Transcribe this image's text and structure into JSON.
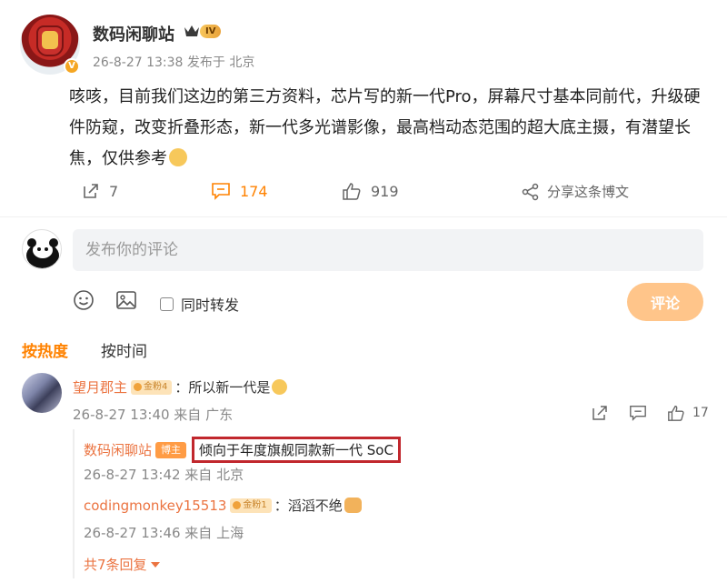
{
  "post": {
    "author": "数码闲聊站",
    "level": "IV",
    "verified": "V",
    "meta": "26-8-27 13:38  发布于 北京",
    "text": "咳咳，目前我们这边的第三方资料，芯片写的新一代Pro，屏幕尺寸基本同前代，升级硬件防窥，改变折叠形态，新一代多光谱影像，最高档动态范围的超大底主摄，有潜望长焦，仅供参考"
  },
  "actions": {
    "repost_count": "7",
    "comment_count": "174",
    "like_count": "919",
    "share_label": "分享这条博文"
  },
  "composer": {
    "placeholder": "发布你的评论",
    "repost_label": "同时转发",
    "submit_label": "评论"
  },
  "sort": {
    "hot_label": "按热度",
    "time_label": "按时间"
  },
  "comment": {
    "user": "望月郡主",
    "fan_badge": "金粉4",
    "text": "：所以新一代是",
    "meta": "26-8-27 13:40  来自 广东",
    "like_count": "17"
  },
  "replies": [
    {
      "user": "数码闲聊站",
      "role_badge": "博主",
      "text": "倾向于年度旗舰同款新一代 SoC",
      "meta": "26-8-27 13:42  来自 北京"
    },
    {
      "user": "codingmonkey15513",
      "fan_badge": "金粉1",
      "text": "：滔滔不绝",
      "meta": "26-8-27 13:46  来自 上海"
    }
  ],
  "more_replies": "共7条回复",
  "colors": {
    "accent": "#ff8200",
    "username": "#eb7340",
    "highlight_border": "#c1272d",
    "submit_disabled": "#ffc58a"
  }
}
